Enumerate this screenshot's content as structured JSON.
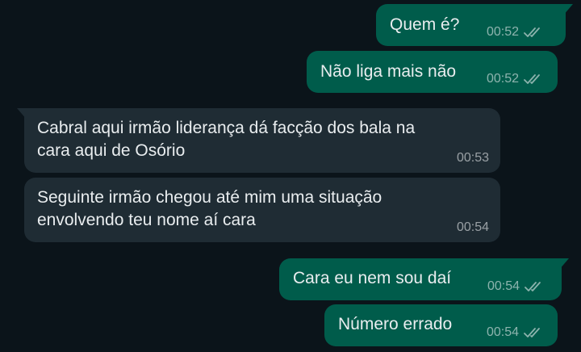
{
  "messages": [
    {
      "direction": "out",
      "text": "Quem é?",
      "time": "00:52",
      "status": "read-double-check-icon"
    },
    {
      "direction": "out",
      "text": "Não liga mais não",
      "time": "00:52",
      "status": "read-double-check-icon"
    },
    {
      "direction": "in",
      "text": "Cabral aqui irmão liderança dá facção dos bala na\ncara aqui de Osório",
      "time": "00:53"
    },
    {
      "direction": "in",
      "text": "Seguinte irmão chegou até mim uma situação\nenvolvendo teu nome aí cara",
      "time": "00:54"
    },
    {
      "direction": "out",
      "text": "Cara eu nem sou daí",
      "time": "00:54",
      "status": "read-double-check-icon"
    },
    {
      "direction": "out",
      "text": "Número errado",
      "time": "00:54",
      "status": "read-double-check-icon"
    }
  ],
  "colors": {
    "background": "#0b141a",
    "outgoing_bubble": "#005c4b",
    "incoming_bubble": "#1f2c34",
    "text": "#e9edef"
  }
}
